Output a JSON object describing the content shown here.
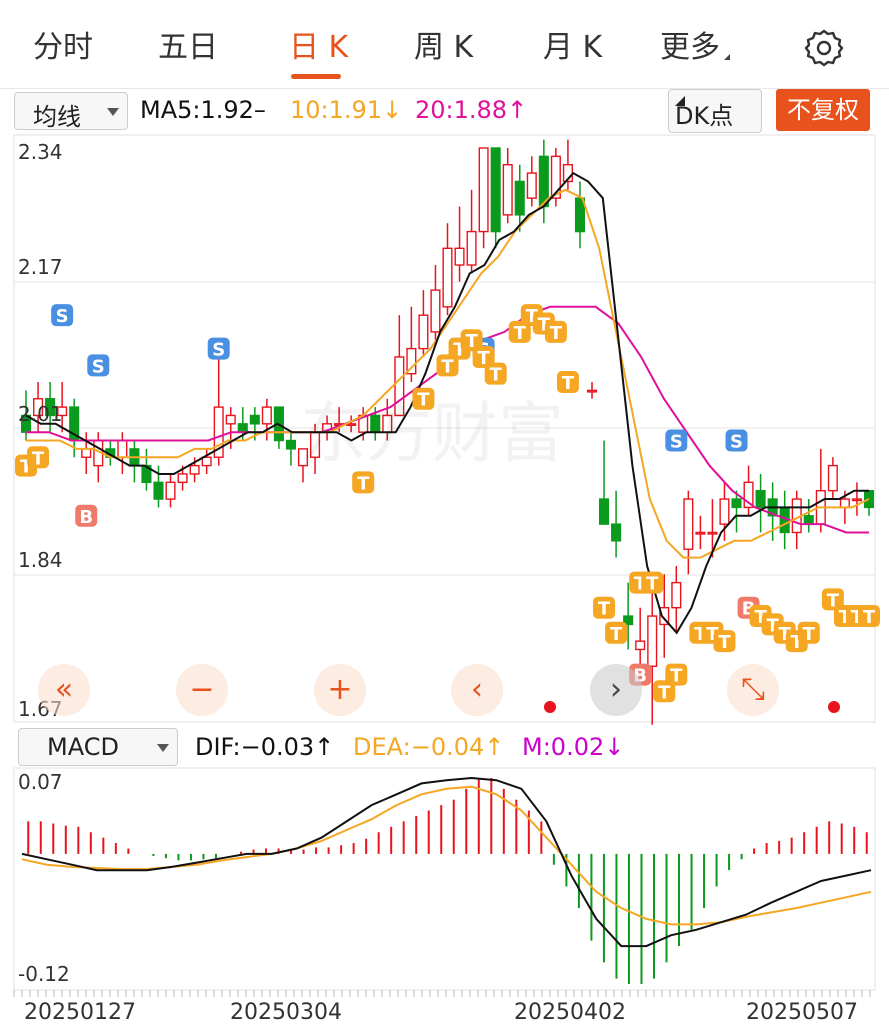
{
  "tabs": [
    {
      "label": "分时",
      "active": false
    },
    {
      "label": "五日",
      "active": false
    },
    {
      "label": "日 K",
      "active": true
    },
    {
      "label": "周 K",
      "active": false
    },
    {
      "label": "月 K",
      "active": false
    },
    {
      "label": "更多",
      "active": false
    }
  ],
  "settings_icon": "gear-icon",
  "indicator_select": "均线",
  "ma": {
    "ma5": "MA5:1.92–",
    "ma10": "10:1.91↓",
    "ma20": "20:1.88↑",
    "colors": {
      "ma5": "#111111",
      "ma10": "#f5a623",
      "ma20": "#e0109a"
    }
  },
  "dk_button": "DK点",
  "fq_button": "不复权",
  "price_axis": [
    "2.34",
    "2.17",
    "2.01",
    "1.84",
    "1.67"
  ],
  "watermark": "东方财富",
  "macd_select": "MACD",
  "macd_legend": {
    "dif": "DIF:−0.03↑",
    "dea": "DEA:−0.04↑",
    "m": "M:0.02↓",
    "colors": {
      "dif": "#111111",
      "dea": "#f5a623",
      "m": "#cc00cc"
    }
  },
  "macd_axis": [
    "0.07",
    "-0.12"
  ],
  "dates": [
    "20250127",
    "20250304",
    "20250402",
    "20250507"
  ],
  "nav_buttons": [
    {
      "name": "scroll-far-left-button",
      "glyph": "«"
    },
    {
      "name": "zoom-out-button",
      "glyph": "−"
    },
    {
      "name": "zoom-in-button",
      "glyph": "+"
    },
    {
      "name": "scroll-left-button",
      "glyph": "‹"
    },
    {
      "name": "scroll-right-button",
      "glyph": "›"
    },
    {
      "name": "fullscreen-button",
      "glyph": "⤡"
    }
  ],
  "markers": {
    "s": "S",
    "b": "B",
    "t": "T"
  },
  "chart_data": {
    "type": "candlestick",
    "ylim": [
      1.67,
      2.34
    ],
    "macd_ylim": [
      -0.12,
      0.07
    ],
    "colors": {
      "up": "#e8131d",
      "down": "#0a9a1e"
    },
    "candles": [
      [
        2.02,
        2.0,
        2.05,
        1.99
      ],
      [
        2.02,
        2.04,
        2.06,
        2.0
      ],
      [
        2.04,
        2.02,
        2.06,
        2.0
      ],
      [
        2.02,
        2.03,
        2.06,
        2.0
      ],
      [
        2.03,
        1.99,
        2.04,
        1.97
      ],
      [
        1.97,
        1.98,
        2.0,
        1.95
      ],
      [
        1.96,
        1.99,
        2.0,
        1.94
      ],
      [
        1.98,
        1.97,
        1.99,
        1.96
      ],
      [
        1.97,
        1.99,
        2.0,
        1.95
      ],
      [
        1.98,
        1.96,
        1.99,
        1.94
      ],
      [
        1.96,
        1.94,
        1.98,
        1.93
      ],
      [
        1.94,
        1.92,
        1.96,
        1.91
      ],
      [
        1.92,
        1.94,
        1.95,
        1.91
      ],
      [
        1.94,
        1.95,
        1.96,
        1.93
      ],
      [
        1.95,
        1.96,
        1.97,
        1.94
      ],
      [
        1.96,
        1.97,
        1.98,
        1.95
      ],
      [
        1.97,
        2.03,
        2.09,
        1.96
      ],
      [
        2.01,
        2.02,
        2.03,
        1.98
      ],
      [
        2.01,
        2.0,
        2.03,
        1.99
      ],
      [
        2.02,
        2.01,
        2.03,
        1.99
      ],
      [
        2.01,
        2.03,
        2.04,
        1.99
      ],
      [
        2.03,
        1.99,
        2.03,
        1.98
      ],
      [
        1.99,
        1.98,
        2.0,
        1.96
      ],
      [
        1.96,
        1.98,
        1.98,
        1.94
      ],
      [
        1.97,
        2.0,
        2.01,
        1.95
      ],
      [
        2.0,
        2.01,
        2.02,
        1.99
      ],
      [
        2.01,
        2.01,
        2.03,
        2.0
      ],
      [
        2.01,
        2.01,
        2.02,
        2.0
      ],
      [
        2.0,
        2.02,
        2.03,
        1.99
      ],
      [
        2.02,
        2.0,
        2.03,
        1.99
      ],
      [
        2.0,
        2.02,
        2.04,
        1.99
      ],
      [
        2.02,
        2.09,
        2.14,
        2.02
      ],
      [
        2.07,
        2.1,
        2.15,
        2.06
      ],
      [
        2.1,
        2.14,
        2.17,
        2.09
      ],
      [
        2.12,
        2.17,
        2.2,
        2.11
      ],
      [
        2.15,
        2.22,
        2.25,
        2.14
      ],
      [
        2.2,
        2.22,
        2.27,
        2.18
      ],
      [
        2.2,
        2.24,
        2.29,
        2.19
      ],
      [
        2.24,
        2.34,
        2.34,
        2.22
      ],
      [
        2.34,
        2.24,
        2.34,
        2.22
      ],
      [
        2.26,
        2.32,
        2.34,
        2.25
      ],
      [
        2.3,
        2.26,
        2.32,
        2.24
      ],
      [
        2.28,
        2.31,
        2.33,
        2.27
      ],
      [
        2.33,
        2.27,
        2.35,
        2.25
      ],
      [
        2.28,
        2.33,
        2.34,
        2.27
      ],
      [
        2.3,
        2.32,
        2.35,
        2.29
      ],
      [
        2.28,
        2.24,
        2.3,
        2.22
      ],
      [
        2.05,
        2.05,
        2.06,
        2.04
      ],
      [
        1.92,
        1.89,
        1.99,
        1.89
      ],
      [
        1.89,
        1.87,
        1.93,
        1.85
      ],
      [
        1.78,
        1.77,
        1.82,
        1.74
      ],
      [
        1.74,
        1.75,
        1.79,
        1.7
      ],
      [
        1.72,
        1.78,
        1.81,
        1.65
      ],
      [
        1.77,
        1.79,
        1.83,
        1.73
      ],
      [
        1.79,
        1.82,
        1.84,
        1.76
      ],
      [
        1.86,
        1.92,
        1.93,
        1.83
      ],
      [
        1.88,
        1.88,
        1.9,
        1.86
      ],
      [
        1.88,
        1.88,
        1.92,
        1.85
      ],
      [
        1.89,
        1.92,
        1.94,
        1.87
      ],
      [
        1.92,
        1.91,
        1.93,
        1.88
      ],
      [
        1.91,
        1.94,
        1.96,
        1.9
      ],
      [
        1.93,
        1.91,
        1.95,
        1.88
      ],
      [
        1.92,
        1.9,
        1.94,
        1.87
      ],
      [
        1.91,
        1.88,
        1.93,
        1.86
      ],
      [
        1.88,
        1.92,
        1.93,
        1.86
      ],
      [
        1.9,
        1.89,
        1.92,
        1.88
      ],
      [
        1.89,
        1.93,
        1.98,
        1.88
      ],
      [
        1.93,
        1.96,
        1.97,
        1.92
      ],
      [
        1.91,
        1.92,
        1.93,
        1.89
      ],
      [
        1.92,
        1.92,
        1.94,
        1.9
      ],
      [
        1.93,
        1.91,
        1.93,
        1.9
      ]
    ],
    "ma5": [
      2.02,
      2.01,
      2.01,
      2.0,
      1.99,
      1.98,
      1.97,
      1.96,
      1.96,
      1.95,
      1.95,
      1.96,
      1.97,
      1.98,
      1.99,
      2.0,
      2.0,
      2.01,
      2.0,
      2.0,
      2.0,
      2.0,
      1.99,
      2.0,
      2.0,
      2.0,
      2.03,
      2.07,
      2.12,
      2.15,
      2.19,
      2.2,
      2.23,
      2.24,
      2.26,
      2.27,
      2.29,
      2.31,
      2.3,
      2.28,
      2.12,
      1.96,
      1.84,
      1.78,
      1.76,
      1.79,
      1.84,
      1.88,
      1.9,
      1.9,
      1.91,
      1.91,
      1.91,
      1.91,
      1.92,
      1.92,
      1.93,
      1.93
    ],
    "ma10": [
      1.99,
      1.99,
      1.99,
      1.98,
      1.98,
      1.97,
      1.97,
      1.97,
      1.97,
      1.97,
      1.98,
      1.98,
      1.99,
      1.99,
      2.0,
      2.0,
      2.0,
      2.0,
      2.0,
      2.01,
      2.02,
      2.04,
      2.06,
      2.08,
      2.1,
      2.13,
      2.16,
      2.19,
      2.21,
      2.24,
      2.26,
      2.28,
      2.29,
      2.28,
      2.22,
      2.12,
      2.02,
      1.92,
      1.87,
      1.85,
      1.85,
      1.86,
      1.87,
      1.87,
      1.88,
      1.89,
      1.9,
      1.91,
      1.91,
      1.91,
      1.92
    ],
    "ma20": [
      2.0,
      2.0,
      1.99,
      1.99,
      1.99,
      1.99,
      1.99,
      1.99,
      1.99,
      2.0,
      2.0,
      2.0,
      2.0,
      2.0,
      2.01,
      2.02,
      2.03,
      2.05,
      2.07,
      2.09,
      2.11,
      2.12,
      2.14,
      2.15,
      2.15,
      2.15,
      2.13,
      2.09,
      2.04,
      2.0,
      1.96,
      1.93,
      1.91,
      1.9,
      1.89,
      1.89,
      1.88,
      1.88
    ],
    "macd_dif": [
      0.0,
      -0.005,
      -0.01,
      -0.015,
      -0.015,
      -0.015,
      -0.012,
      -0.008,
      -0.004,
      0.0,
      0.0,
      0.005,
      0.015,
      0.03,
      0.045,
      0.055,
      0.065,
      0.068,
      0.07,
      0.068,
      0.06,
      0.03,
      -0.02,
      -0.06,
      -0.085,
      -0.085,
      -0.075,
      -0.07,
      -0.063,
      -0.056,
      -0.045,
      -0.035,
      -0.025,
      -0.02,
      -0.015
    ],
    "macd_dea": [
      -0.005,
      -0.01,
      -0.012,
      -0.013,
      -0.014,
      -0.014,
      -0.012,
      -0.01,
      -0.006,
      -0.003,
      0.0,
      0.005,
      0.012,
      0.022,
      0.032,
      0.045,
      0.055,
      0.06,
      0.062,
      0.055,
      0.04,
      0.015,
      -0.01,
      -0.035,
      -0.05,
      -0.06,
      -0.065,
      -0.065,
      -0.063,
      -0.058,
      -0.054,
      -0.05,
      -0.045,
      -0.04,
      -0.035
    ],
    "macd_bars": [
      0.03,
      0.03,
      0.028,
      0.026,
      0.025,
      0.02,
      0.015,
      0.01,
      0.005,
      0.0,
      -0.002,
      -0.004,
      -0.006,
      -0.006,
      -0.005,
      -0.004,
      0.0,
      0.002,
      0.004,
      0.005,
      0.005,
      0.004,
      0.004,
      0.006,
      0.006,
      0.008,
      0.01,
      0.014,
      0.02,
      0.025,
      0.03,
      0.035,
      0.04,
      0.045,
      0.05,
      0.06,
      0.07,
      0.07,
      0.06,
      0.05,
      0.04,
      0.03,
      -0.01,
      -0.03,
      -0.05,
      -0.08,
      -0.1,
      -0.115,
      -0.12,
      -0.12,
      -0.115,
      -0.1,
      -0.085,
      -0.07,
      -0.05,
      -0.03,
      -0.015,
      -0.005,
      0.005,
      0.01,
      0.012,
      0.015,
      0.02,
      0.025,
      0.03,
      0.028,
      0.025,
      0.02
    ]
  }
}
